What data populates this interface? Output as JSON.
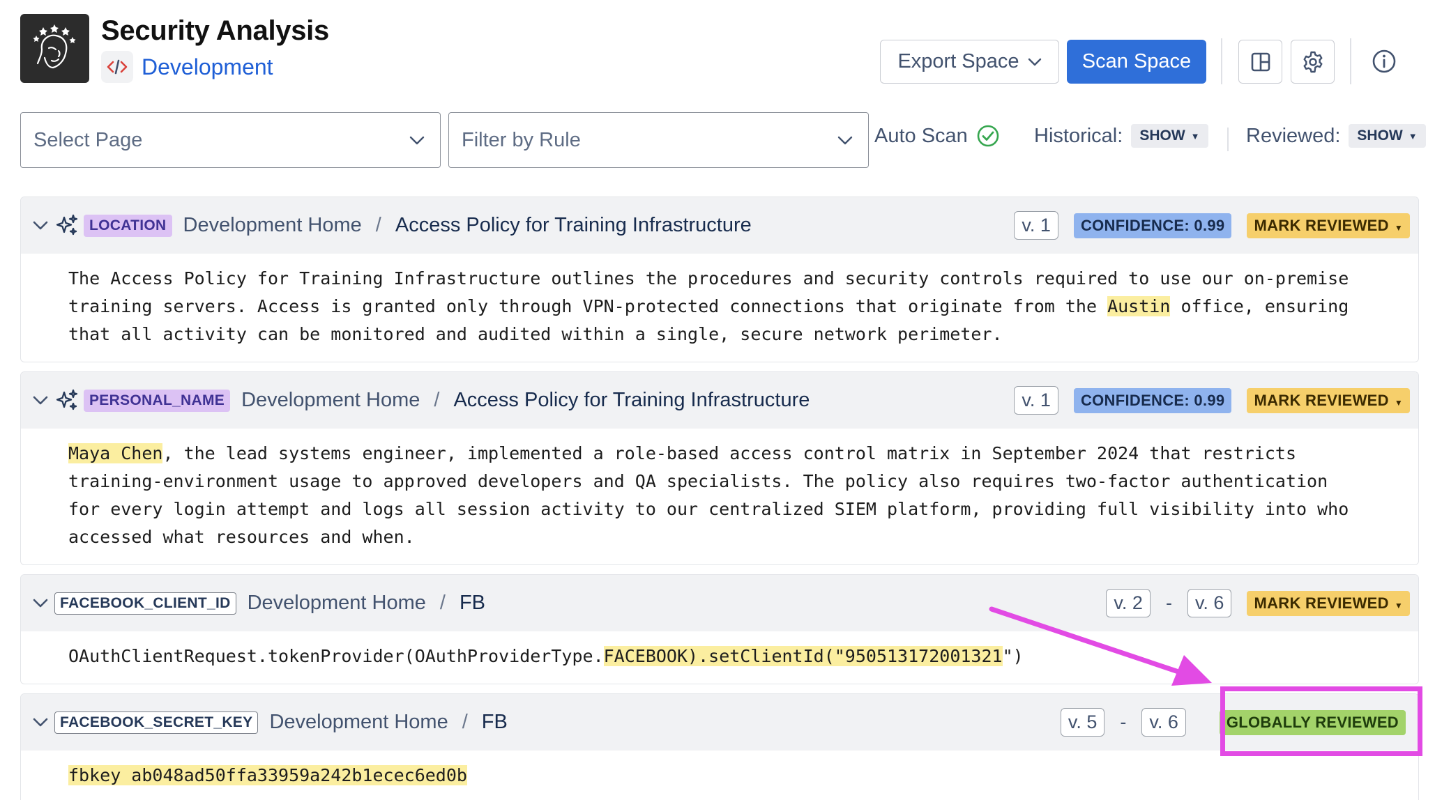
{
  "header": {
    "title": "Security Analysis",
    "space_name": "Development",
    "export_label": "Export Space",
    "scan_label": "Scan Space"
  },
  "filters": {
    "select_page_placeholder": "Select Page",
    "filter_rule_placeholder": "Filter by Rule",
    "auto_scan_label": "Auto Scan",
    "historical_label": "Historical:",
    "historical_value": "SHOW",
    "reviewed_label": "Reviewed:",
    "reviewed_value": "SHOW"
  },
  "results": [
    {
      "rule": "LOCATION",
      "space": "Development Home",
      "page": "Access Policy for Training Infrastructure",
      "version": "v. 1",
      "confidence": "CONFIDENCE: 0.99",
      "status": "MARK REVIEWED",
      "text_before": "The Access Policy for Training Infrastructure outlines the procedures and security controls required to use our on-premise training servers. Access is granted only through VPN-protected connections that originate from the ",
      "text_match": "Austin",
      "text_after": " office, ensuring that all activity can be monitored and audited within a single, secure network perimeter."
    },
    {
      "rule": "PERSONAL_NAME",
      "space": "Development Home",
      "page": "Access Policy for Training Infrastructure",
      "version": "v. 1",
      "confidence": "CONFIDENCE: 0.99",
      "status": "MARK REVIEWED",
      "text_before": "",
      "text_match": "Maya Chen",
      "text_after": ", the lead systems engineer, implemented a role-based access control matrix in September 2024 that restricts training-environment usage to approved developers and QA specialists. The policy also requires two-factor authentication for every login attempt and logs all session activity to our centralized SIEM platform, providing full visibility into who accessed what resources and when."
    },
    {
      "rule": "FACEBOOK_CLIENT_ID",
      "space": "Development Home",
      "page": "FB",
      "version_from": "v. 2",
      "version_to": "v. 6",
      "status": "MARK REVIEWED",
      "text_before": "OAuthClientRequest.tokenProvider(OAuthProviderType.",
      "text_match": "FACEBOOK).setClientId(\"950513172001321",
      "text_after": "\")"
    },
    {
      "rule": "FACEBOOK_SECRET_KEY",
      "space": "Development Home",
      "page": "FB",
      "version_from": "v. 5",
      "version_to": "v. 6",
      "status": "GLOBALLY REVIEWED",
      "text_before": "",
      "text_match": "fbkey ab048ad50ffa33959a242b1ecec6ed0b",
      "text_after": ""
    }
  ],
  "separator": "/",
  "version_dash": "-",
  "colors": {
    "accent": "#2f6fd9",
    "location_tag": "#dcc2f4",
    "confidence": "#8fb3ee",
    "mark_reviewed": "#f6cf6b",
    "globally_reviewed": "#a3d36a",
    "highlight": "#fbeea0",
    "annotation": "#e24be4"
  },
  "icons": {
    "logo": "face-with-stars-logo",
    "space": "code-icon",
    "layout": "layout-panel-icon",
    "settings": "gear-icon",
    "info": "info-icon",
    "ai": "sparkle-icon",
    "ok": "check-circle-icon"
  }
}
